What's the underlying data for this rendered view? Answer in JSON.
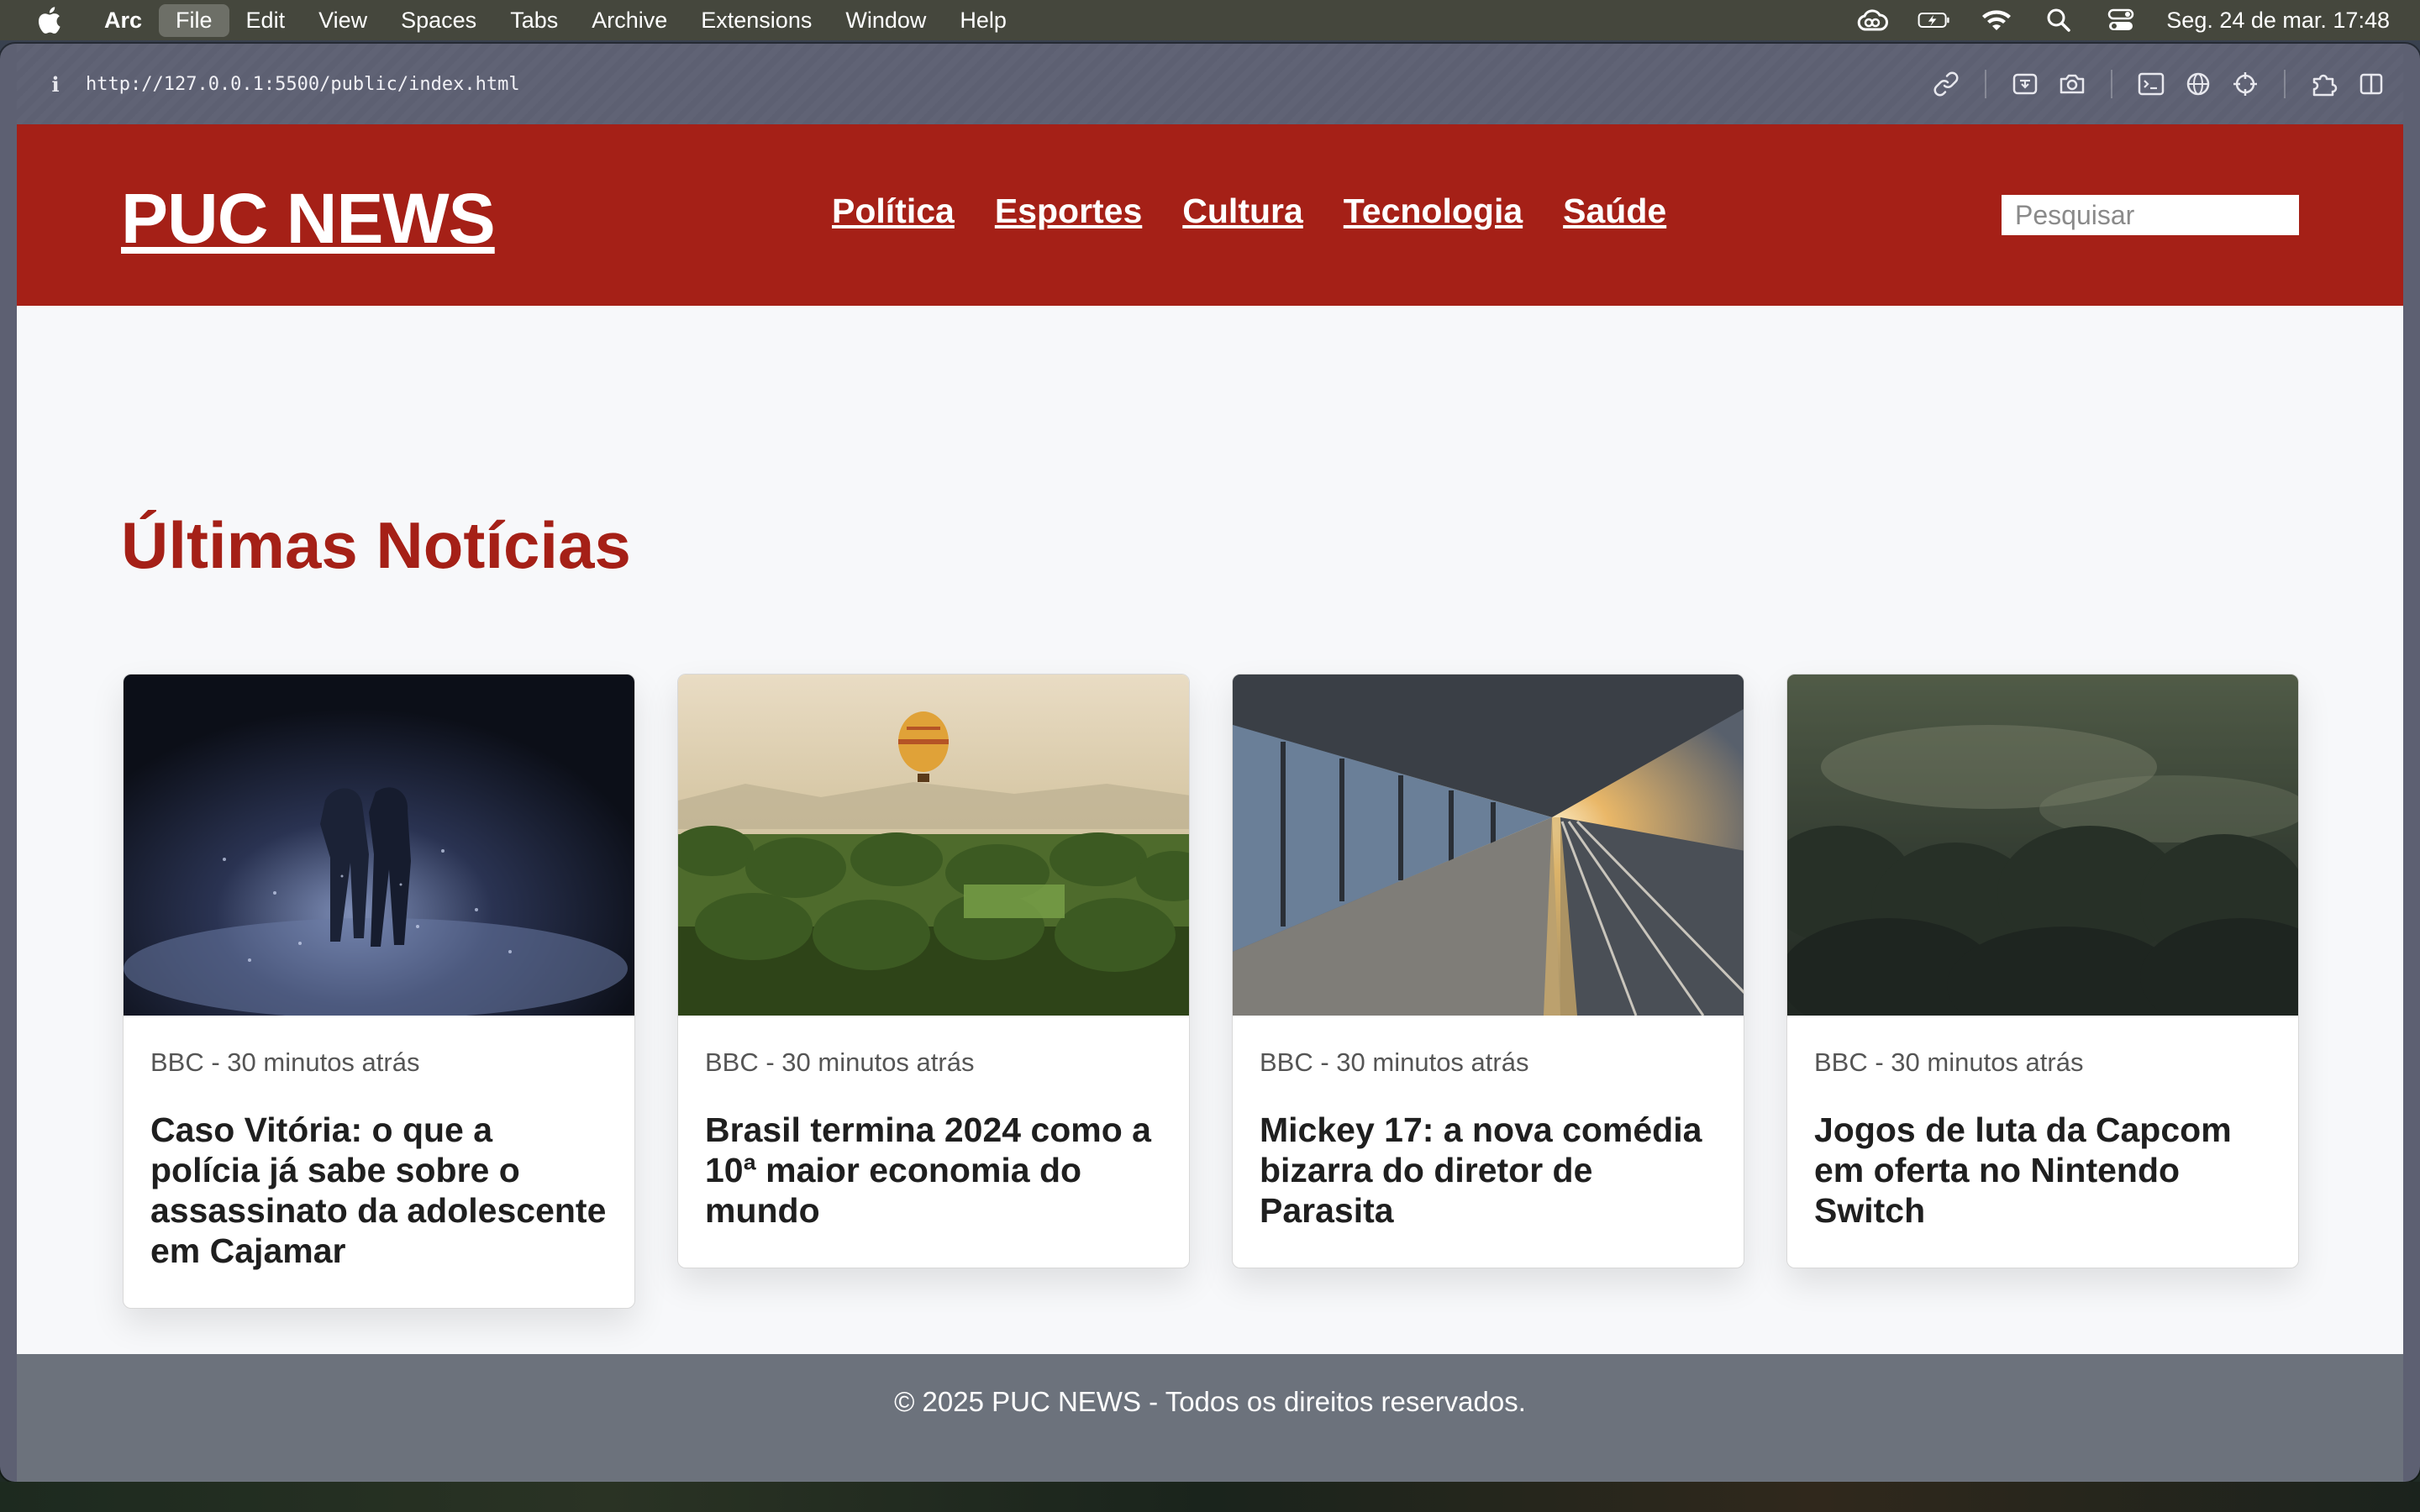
{
  "menubar": {
    "app": "Arc",
    "items": [
      "File",
      "Edit",
      "View",
      "Spaces",
      "Tabs",
      "Archive",
      "Extensions",
      "Window",
      "Help"
    ],
    "active_item": "File",
    "clock": "Seg. 24 de mar.  17:48",
    "status_icons": [
      "creative-cloud-icon",
      "battery-charging-icon",
      "wifi-icon",
      "spotlight-search-icon",
      "control-center-icon"
    ]
  },
  "browser": {
    "info_glyph": "i",
    "url": "http://127.0.0.1:5500/public/index.html",
    "tool_icons": [
      "link-icon",
      "capture-icon",
      "camera-icon",
      "terminal-icon",
      "globe-icon",
      "crosshair-icon",
      "extensions-icon",
      "sidebar-icon"
    ]
  },
  "site": {
    "logo": "PUC NEWS",
    "nav": [
      "Política",
      "Esportes",
      "Cultura",
      "Tecnologia",
      "Saúde"
    ],
    "search_placeholder": "Pesquisar",
    "section_title": "Últimas Notícias",
    "cards": [
      {
        "image": "night-couple-rain-photo",
        "meta": "BBC - 30 minutos atrás",
        "title": "Caso Vitória: o que a polícia já sabe sobre o assassinato da adolescente em Cajamar"
      },
      {
        "image": "palm-trees-balloon-photo",
        "meta": "BBC - 30 minutos atrás",
        "title": "Brasil termina 2024 como a 10ª maior economia do mundo"
      },
      {
        "image": "train-platform-sunset-photo",
        "meta": "BBC - 30 minutos atrás",
        "title": "Mickey 17: a nova comédia bizarra do diretor de Parasita"
      },
      {
        "image": "misty-forest-photo",
        "meta": "BBC - 30 minutos atrás",
        "title": "Jogos de luta da Capcom em oferta no Nintendo Switch"
      }
    ],
    "footer": "© 2025 PUC NEWS - Todos os direitos reservados."
  },
  "colors": {
    "brand_red": "#a52017",
    "footer_gray": "#6c727c",
    "page_bg": "#f7f8fa"
  }
}
